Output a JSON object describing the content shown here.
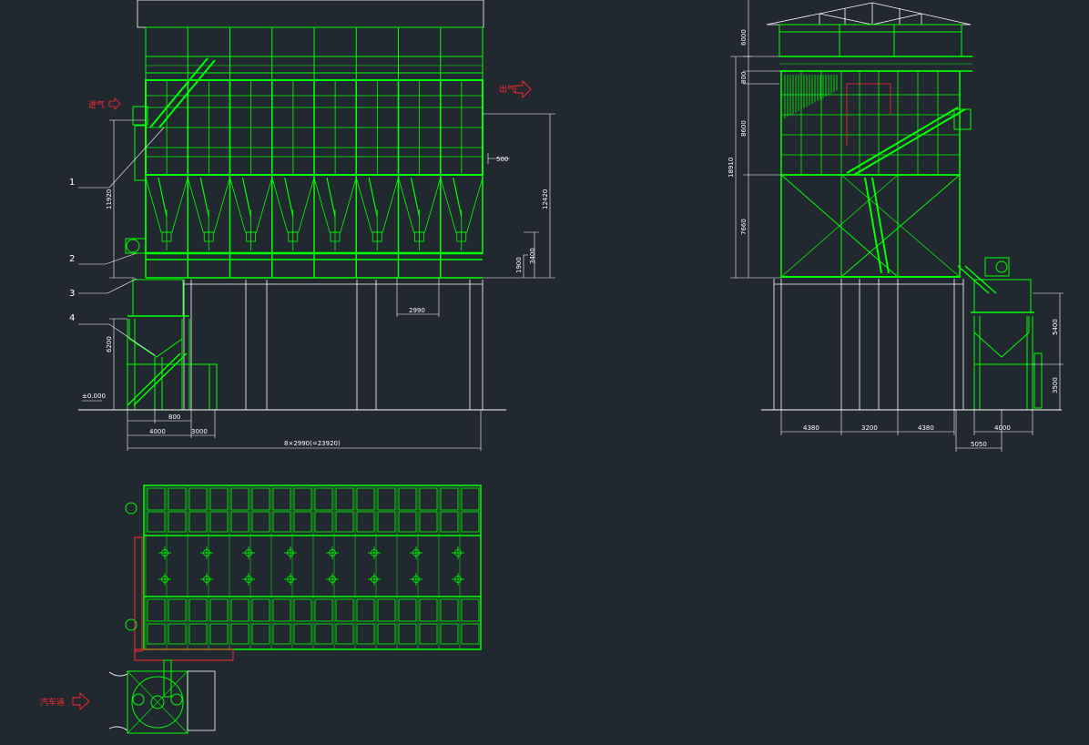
{
  "drawing": {
    "front_view": {
      "air_in_label": "进气",
      "air_out_label": "出气",
      "callouts": [
        "1",
        "2",
        "3",
        "4"
      ],
      "dimensions": {
        "height_11920": "11920",
        "height_6200": "6200",
        "ground_level": "±0.000",
        "width_800": "800",
        "width_4000": "4000",
        "width_3000": "3000",
        "total_length": "8×2990(=23920)",
        "spacing_2990": "2990",
        "offset_500": "500",
        "height_12420": "12420",
        "height_3400": "3400",
        "height_1900": "1900"
      }
    },
    "side_view": {
      "dimensions": {
        "h_6000": "6000",
        "h_800": "800",
        "h_8600": "8600",
        "h_18910": "18910",
        "h_7660": "7660",
        "h_5400": "5400",
        "h_3500": "3500",
        "w_4380a": "4380",
        "w_3200": "3200",
        "w_4380b": "4380",
        "w_4000": "4000",
        "w_5050": "5050"
      }
    },
    "plan_view": {
      "road_label": "汽车道"
    },
    "colors": {
      "background": "#212830",
      "structure": "#00ff00",
      "dimension": "#ffffff",
      "annotation": "#ff2a2a"
    }
  }
}
